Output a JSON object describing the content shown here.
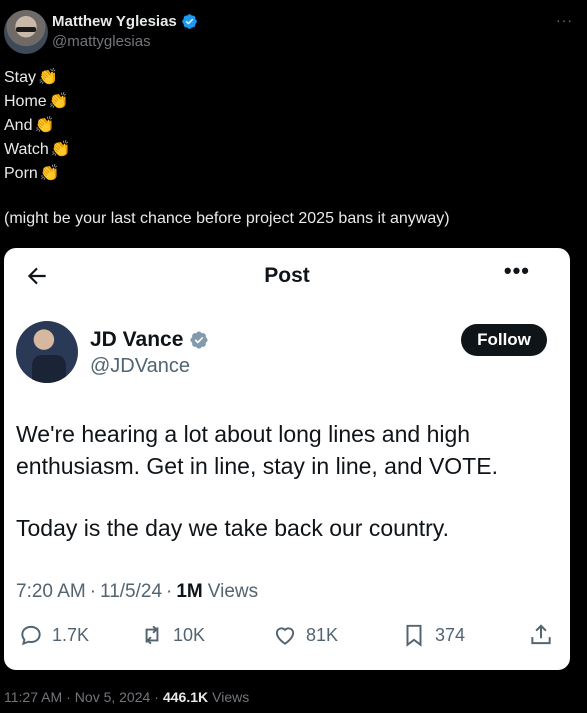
{
  "author": {
    "name": "Matthew Yglesias",
    "handle": "@mattyglesias",
    "more": "···"
  },
  "tweet": {
    "lines": [
      "Stay",
      "Home",
      "And",
      "Watch",
      "Porn"
    ],
    "clap": "👏",
    "note": "(might be your last chance before project 2025 bans it anyway)"
  },
  "quoted": {
    "header_title": "Post",
    "more": "•••",
    "name": "JD Vance",
    "handle": "@JDVance",
    "follow_label": "Follow",
    "body_p1": "We're hearing a lot about long lines and high enthusiasm. Get in line, stay in line, and VOTE.",
    "body_p2": "Today is the day we take back our country.",
    "meta": {
      "time": "7:20 AM",
      "sep": "·",
      "date": "11/5/24",
      "views_count": "1M",
      "views_label": "Views"
    },
    "actions": {
      "replies": "1.7K",
      "reposts": "10K",
      "likes": "81K",
      "bookmarks": "374"
    }
  },
  "footer": {
    "time": "11:27 AM",
    "sep": "·",
    "date": "Nov 5, 2024",
    "views_count": "446.1K",
    "views_label": "Views"
  },
  "colors": {
    "background": "#000000",
    "card_background": "#ffffff",
    "verified_blue": "#1d9bf0",
    "verified_gray": "#829aab",
    "muted_text": "#71767b",
    "card_muted_text": "#536471"
  }
}
